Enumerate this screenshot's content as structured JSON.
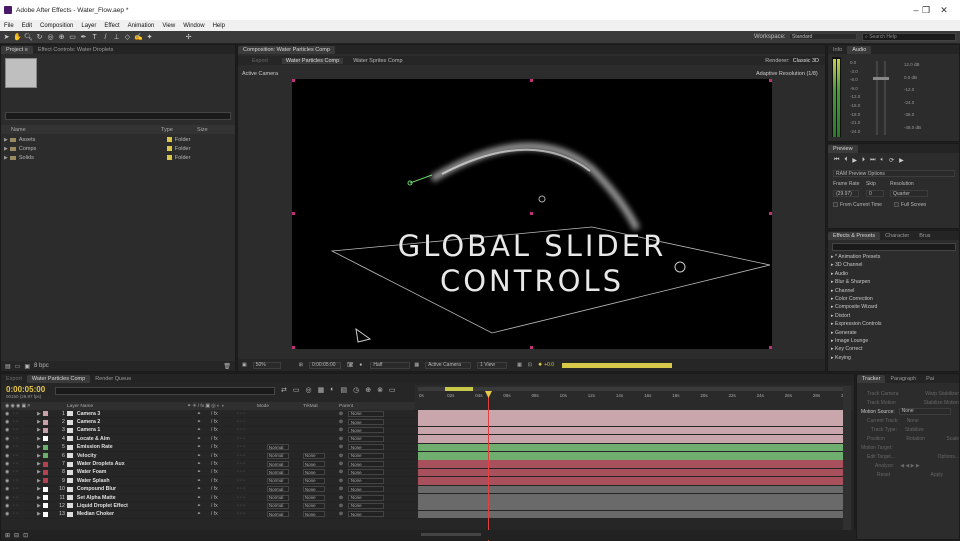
{
  "window": {
    "title": "Adobe After Effects - Water_Flow.aep *"
  },
  "menu": [
    "File",
    "Edit",
    "Composition",
    "Layer",
    "Effect",
    "Animation",
    "View",
    "Window",
    "Help"
  ],
  "toolbar": {
    "workspace_label": "Workspace:",
    "workspace_value": "Standard",
    "search_placeholder": "Search Help"
  },
  "project": {
    "tab_project": "Project ≡",
    "tab_effect": "Effect Controls: Water Droplets",
    "col_name": "Name",
    "col_type": "Type",
    "col_size": "Size",
    "items": [
      {
        "name": "Assets",
        "type": "Folder"
      },
      {
        "name": "Comps",
        "type": "Folder"
      },
      {
        "name": "Solids",
        "type": "Folder"
      }
    ],
    "bpc": "8 bpc"
  },
  "comp": {
    "tab": "Composition: Water Particles Comp",
    "subtabs": [
      "Export",
      "Water Particles Comp",
      "Water Sprites Comp"
    ],
    "renderer_label": "Renderer:",
    "renderer_value": "Classic 3D",
    "active_camera": "Active Camera",
    "adaptive": "Adaptive Resolution (1/8)",
    "overlay_line1": "GLOBAL SLIDER",
    "overlay_line2": "CONTROLS",
    "footer": {
      "zoom": "50%",
      "time": "0:00:05:00",
      "res": "Half",
      "camera": "Active Camera",
      "view": "1 View",
      "plus": "+0.0"
    }
  },
  "info": {
    "tab_info": "Info",
    "tab_audio": "Audio",
    "db_left": [
      "0.0",
      "-3.0",
      "-6.0",
      "-9.0",
      "-12.0",
      "-15.0",
      "-18.0",
      "-21.0",
      "-24.0"
    ],
    "db_right": [
      "12.0 dB",
      "0.0 dB",
      "-12.0",
      "-24.0",
      "-36.0",
      "-48.0 dB"
    ]
  },
  "preview": {
    "tab": "Preview",
    "ram_options": "RAM Preview Options",
    "frame_rate_label": "Frame Rate",
    "skip_label": "Skip",
    "resolution_label": "Resolution",
    "frame_rate_value": "(29.97)",
    "skip_value": "0",
    "resolution_value": "Quarter",
    "from_current": "From Current Time",
    "full_screen": "Full Screen"
  },
  "effects": {
    "tabs": [
      "Effects & Presets",
      "Character",
      "Brus"
    ],
    "items": [
      "* Animation Presets",
      "3D Channel",
      "Audio",
      "Blur & Sharpen",
      "Channel",
      "Color Correction",
      "Composite Wizard",
      "Distort",
      "Expression Controls",
      "Generate",
      "Image Lounge",
      "Key Correct",
      "Keying"
    ]
  },
  "timeline": {
    "tabs": [
      "Export",
      "Water Particles Comp",
      "Render Queue"
    ],
    "timecode": "0:00:05:00",
    "frames": "00150 (29.97 fps)",
    "col_layer": "Layer Name",
    "col_mode": "Mode",
    "col_trkmat": "TrkMat",
    "col_parent": "Parent",
    "ruler": [
      "0s",
      "02s",
      "04s",
      "06s",
      "08s",
      "10s",
      "12s",
      "14s",
      "16s",
      "18s",
      "20s",
      "22s",
      "24s",
      "26s",
      "28s",
      "30s"
    ],
    "layers": [
      {
        "num": "1",
        "name": "Camera 3",
        "color": "#c9a0a8",
        "mode": "",
        "trk": "",
        "parent": "None",
        "bar": "#c8a6ab"
      },
      {
        "num": "2",
        "name": "Camera 2",
        "color": "#c9a0a8",
        "mode": "",
        "trk": "",
        "parent": "None",
        "bar": "#c8a6ab"
      },
      {
        "num": "3",
        "name": "Camera 1",
        "color": "#c9a0a8",
        "mode": "",
        "trk": "",
        "parent": "None",
        "bar": "#c8a6ab"
      },
      {
        "num": "4",
        "name": "Locate & Aim",
        "color": "#ffffff",
        "mode": "",
        "trk": "",
        "parent": "None",
        "bar": "#c8a6ab"
      },
      {
        "num": "5",
        "name": "Emission Rate",
        "color": "#69b06a",
        "mode": "Normal",
        "trk": "",
        "parent": "None",
        "bar": "#6fae6f"
      },
      {
        "num": "6",
        "name": "Velocity",
        "color": "#69b06a",
        "mode": "Normal",
        "trk": "None",
        "parent": "None",
        "bar": "#6fae6f"
      },
      {
        "num": "7",
        "name": "Water Droplets Aux",
        "color": "#b54050",
        "mode": "Normal",
        "trk": "None",
        "parent": "None",
        "bar": "#a8505c"
      },
      {
        "num": "8",
        "name": "Water Foam",
        "color": "#b54050",
        "mode": "Normal",
        "trk": "None",
        "parent": "None",
        "bar": "#a8505c"
      },
      {
        "num": "9",
        "name": "Water Splash",
        "color": "#b54050",
        "mode": "Normal",
        "trk": "None",
        "parent": "None",
        "bar": "#a8505c"
      },
      {
        "num": "10",
        "name": "Compound Blur",
        "color": "#ffffff",
        "mode": "Normal",
        "trk": "None",
        "parent": "None",
        "bar": "#6a6a6a"
      },
      {
        "num": "11",
        "name": "Set Alpha Matte",
        "color": "#ffffff",
        "mode": "Normal",
        "trk": "None",
        "parent": "None",
        "bar": "#6a6a6a"
      },
      {
        "num": "12",
        "name": "Liquid Droplet Effect",
        "color": "#ffffff",
        "mode": "Normal",
        "trk": "None",
        "parent": "None",
        "bar": "#6a6a6a"
      },
      {
        "num": "13",
        "name": "Median Choker",
        "color": "#ffffff",
        "mode": "Normal",
        "trk": "None",
        "parent": "None",
        "bar": "#6a6a6a"
      }
    ]
  },
  "tracker": {
    "tabs": [
      "Tracker",
      "Paragraph",
      "Pai"
    ],
    "track_camera": "Track Camera",
    "warp_stabilizer": "Warp Stabilizer",
    "track_motion": "Track Motion",
    "stabilize_motion": "Stabilize Motion",
    "motion_source_label": "Motion Source:",
    "motion_source_value": "None",
    "current_track_label": "Current Track:",
    "current_track_value": "None",
    "track_type_label": "Track Type:",
    "track_type_value": "Stabilize",
    "position": "Position",
    "rotation": "Rotation",
    "scale": "Scale",
    "motion_target": "Motion Target:",
    "edit_target": "Edit Target...",
    "options": "Options...",
    "analyze": "Analyze:",
    "reset": "Reset",
    "apply": "Apply"
  }
}
